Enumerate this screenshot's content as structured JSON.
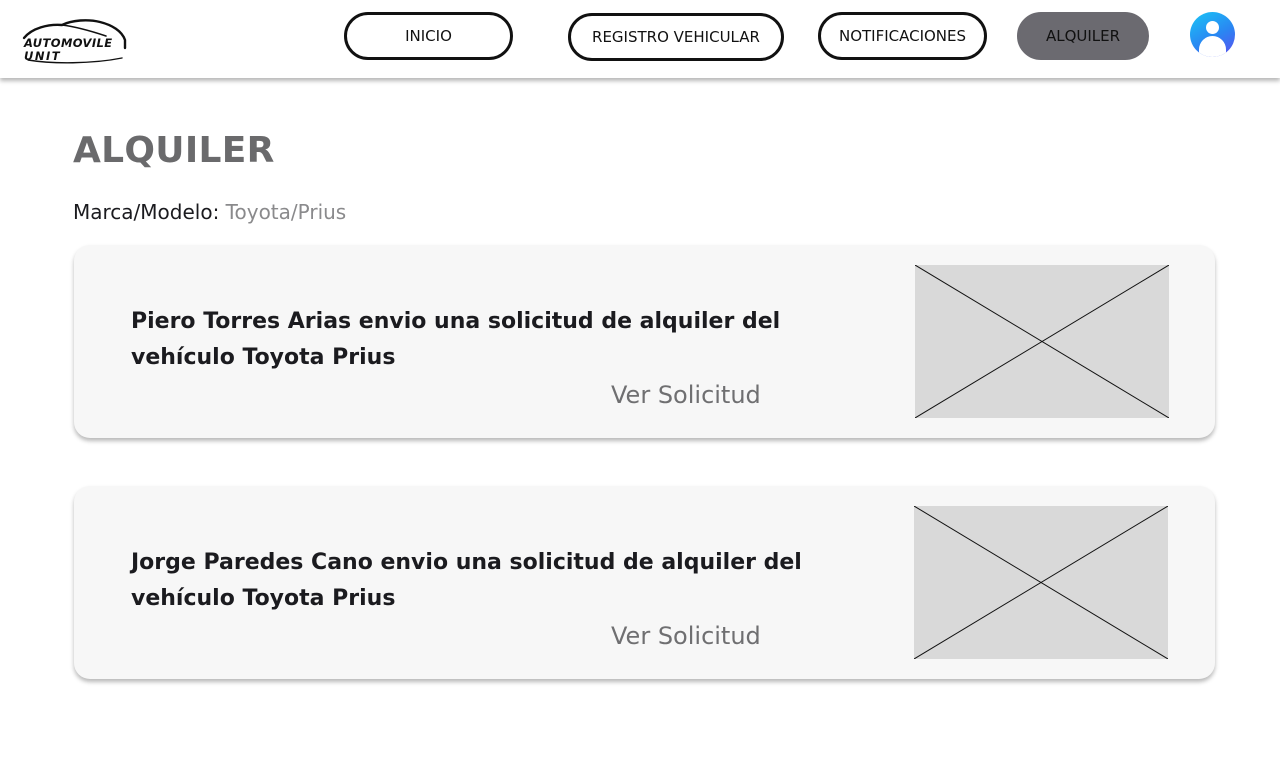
{
  "brand": {
    "logo_line1": "AUTOMOVILE",
    "logo_line2": "UNIT"
  },
  "nav": {
    "items": [
      {
        "label": "INICIO"
      },
      {
        "label": "REGISTRO VEHICULAR"
      },
      {
        "label": "NOTIFICACIONES"
      },
      {
        "label": "ALQUILER",
        "active": true
      }
    ]
  },
  "user": {
    "avatar_icon": "user-avatar-icon"
  },
  "page": {
    "title": "ALQUILER",
    "brand_label": "Marca/Modelo:",
    "brand_value": "Toyota/Prius"
  },
  "requests": [
    {
      "message": "Piero Torres Arias envio una solicitud de alquiler del vehículo Toyota Prius",
      "link": "Ver Solicitud",
      "image_icon": "image-placeholder-icon"
    },
    {
      "message": "Jorge Paredes Cano  envio una solicitud de alquiler del vehículo Toyota Prius",
      "link": "Ver Solicitud",
      "image_icon": "image-placeholder-icon"
    }
  ],
  "colors": {
    "active_nav": "#6b6a70",
    "title": "#6a6a6c",
    "card_bg": "#f7f7f7",
    "placeholder": "#d9d9d9",
    "avatar_gradient": [
      "#19c6f6",
      "#5d4cf0"
    ]
  }
}
